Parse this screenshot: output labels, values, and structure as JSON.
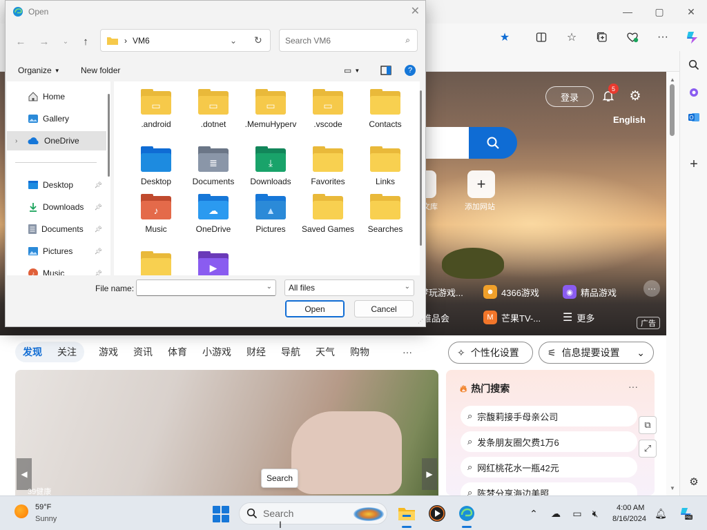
{
  "browser": {
    "window_controls": {
      "minimize": "—",
      "maximize": "▢",
      "close": "✕"
    },
    "toolbar_icons": [
      "favorite-star-icon",
      "split-screen-icon",
      "favorites-icon",
      "collections-icon",
      "browser-essentials-icon",
      "more-icon",
      "copilot-icon"
    ],
    "sidebar_icons": [
      "search-icon",
      "copilot-icon",
      "outlook-icon",
      "add-icon",
      "settings-icon"
    ]
  },
  "page": {
    "login_label": "登录",
    "notification_count": "5",
    "language_link": "English",
    "quick_links": [
      {
        "label": "文库"
      },
      {
        "label": "添加网站"
      }
    ],
    "game_links": [
      {
        "label": "梦玩游戏..."
      },
      {
        "label": "4366游戏"
      },
      {
        "label": "精品游戏"
      },
      {
        "label": "唯品会"
      },
      {
        "label": "芒果TV-..."
      },
      {
        "label": "更多"
      }
    ],
    "ad_label": "广告",
    "feed_tabs": [
      "发现",
      "关注"
    ],
    "feed_categories": [
      "游戏",
      "资讯",
      "体育",
      "小游戏",
      "财经",
      "导航",
      "天气",
      "购物"
    ],
    "feed_more": "···",
    "personalize_label": "个性化设置",
    "digest_label": "信息提要设置",
    "card_source": "39健康",
    "search_tooltip": "Search",
    "hot_search": {
      "title": "热门搜索",
      "more": "···",
      "items": [
        "宗馥莉接手母亲公司",
        "发条朋友圈欠费1万6",
        "网红桃花水一瓶42元",
        "陈梦分享海边美照"
      ]
    }
  },
  "dialog": {
    "title": "Open",
    "path_folder": "VM6",
    "search_placeholder": "Search VM6",
    "organize_label": "Organize",
    "new_folder_label": "New folder",
    "nav_items": [
      {
        "label": "Home",
        "icon": "home-icon"
      },
      {
        "label": "Gallery",
        "icon": "gallery-icon"
      },
      {
        "label": "OneDrive",
        "icon": "onedrive-icon"
      },
      {
        "label": "Desktop",
        "icon": "desktop-icon"
      },
      {
        "label": "Downloads",
        "icon": "downloads-icon"
      },
      {
        "label": "Documents",
        "icon": "documents-icon"
      },
      {
        "label": "Pictures",
        "icon": "pictures-icon"
      },
      {
        "label": "Music",
        "icon": "music-icon"
      }
    ],
    "files": [
      {
        "name": ".android",
        "kind": "doc-folder"
      },
      {
        "name": ".dotnet",
        "kind": "doc-folder"
      },
      {
        "name": ".MemuHyperv",
        "kind": "doc-folder"
      },
      {
        "name": ".vscode",
        "kind": "doc-folder"
      },
      {
        "name": "Contacts",
        "kind": "folder"
      },
      {
        "name": "Desktop",
        "kind": "desktop"
      },
      {
        "name": "Documents",
        "kind": "documents"
      },
      {
        "name": "Downloads",
        "kind": "downloads"
      },
      {
        "name": "Favorites",
        "kind": "folder"
      },
      {
        "name": "Links",
        "kind": "folder"
      },
      {
        "name": "Music",
        "kind": "music"
      },
      {
        "name": "OneDrive",
        "kind": "onedrive"
      },
      {
        "name": "Pictures",
        "kind": "pictures"
      },
      {
        "name": "Saved Games",
        "kind": "folder"
      },
      {
        "name": "Searches",
        "kind": "folder"
      },
      {
        "name": "",
        "kind": "folder"
      },
      {
        "name": "",
        "kind": "videos"
      }
    ],
    "filename_label": "File name:",
    "filename_value": "",
    "filetype_value": "All files",
    "open_label": "Open",
    "cancel_label": "Cancel"
  },
  "taskbar": {
    "weather_temp": "59°F",
    "weather_condition": "Sunny",
    "search_placeholder": "Search",
    "time": "4:00 AM",
    "date": "8/16/2024"
  },
  "colors": {
    "accent": "#0f6cd4",
    "folder_yellow": "#f6c94a",
    "badge_red": "#e83a2f"
  }
}
